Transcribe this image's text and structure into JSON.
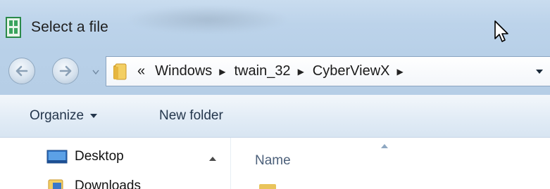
{
  "window": {
    "title": "Select a file",
    "icons": {
      "app": "dialog-app-icon",
      "cursor": "mouse-pointer-icon"
    }
  },
  "navigation": {
    "back_icon": "back-arrow-icon",
    "forward_icon": "forward-arrow-icon",
    "history_icon": "chevron-down-icon",
    "address": {
      "overflow": "«",
      "crumbs": [
        "Windows",
        "twain_32",
        "CyberViewX"
      ],
      "separator_icon": "triangle-right-icon",
      "folder_icon": "folder-icon",
      "dropdown_icon": "chevron-down-icon"
    }
  },
  "toolbar": {
    "organize_label": "Organize",
    "new_folder_label": "New folder"
  },
  "nav_pane": {
    "items": [
      {
        "label": "Desktop",
        "icon": "desktop-icon"
      },
      {
        "label": "Downloads",
        "icon": "downloads-folder-icon"
      }
    ]
  },
  "file_list": {
    "columns": [
      {
        "label": "Name",
        "sort": "ascending"
      }
    ]
  },
  "colors": {
    "titlebar": "#bcd3ea",
    "toolbar": "#e2ecf6",
    "toolbar_text": "#24364c",
    "column_header_text": "#4c607a"
  }
}
